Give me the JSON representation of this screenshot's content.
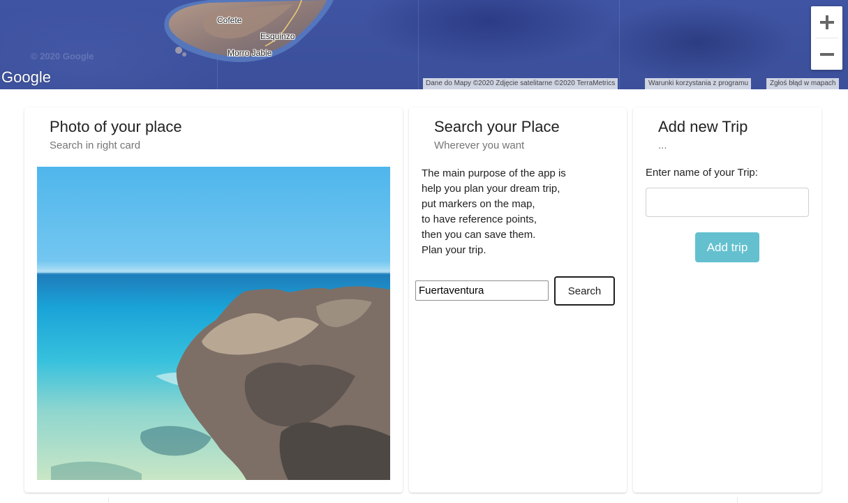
{
  "map": {
    "places": [
      "Cofete",
      "Esquinzo",
      "Morro Jable"
    ],
    "faint_copyright": "© 2020 Google",
    "logo": "Google",
    "attribution": [
      "Dane do Mapy ©2020 Zdjęcie satelitarne ©2020 TerraMetrics",
      "Warunki korzystania z programu",
      "Zgłoś błąd w mapach"
    ],
    "zoom_in_icon": "plus-icon",
    "zoom_out_icon": "minus-icon"
  },
  "photo_card": {
    "title": "Photo of your place",
    "subtitle": "Search in right card"
  },
  "search_card": {
    "title": "Search your Place",
    "subtitle": "Wherever you want",
    "description": [
      "The main purpose of the app is",
      "help you plan your dream trip,",
      "put markers on the map,",
      "to have reference points,",
      "then you can save them.",
      "Plan your trip."
    ],
    "search_value": "Fuertaventura",
    "search_button": "Search"
  },
  "trip_card": {
    "title": "Add new Trip",
    "subtitle": "...",
    "label": "Enter name of your Trip:",
    "input_value": "",
    "button": "Add trip"
  },
  "colors": {
    "map_ocean": "#3f54a3",
    "add_button": "#64c0cf",
    "subtitle": "#757575"
  }
}
